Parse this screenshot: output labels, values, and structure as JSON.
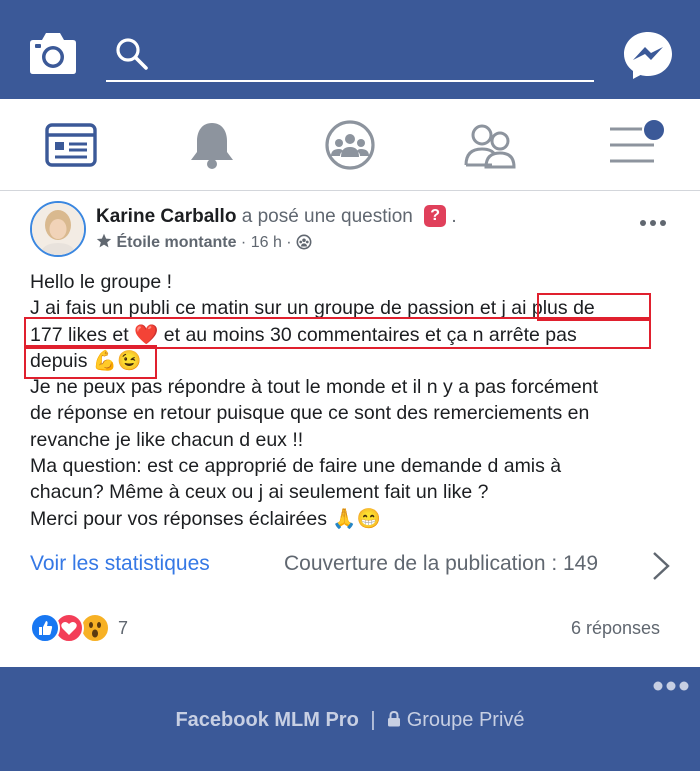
{
  "topbar": {
    "camera_icon": "camera-icon",
    "search_icon": "search-icon",
    "search_placeholder": "",
    "messenger_icon": "messenger-icon",
    "color": "#3b5998"
  },
  "nav": {
    "items": [
      {
        "name": "news-feed",
        "icon": "news-feed-icon",
        "active": true
      },
      {
        "name": "notifications",
        "icon": "bell-icon",
        "active": false
      },
      {
        "name": "groups",
        "icon": "groups-icon",
        "active": false
      },
      {
        "name": "friends",
        "icon": "friends-icon",
        "active": false
      },
      {
        "name": "menu",
        "icon": "menu-icon",
        "active": false,
        "has_dot": true
      }
    ]
  },
  "post": {
    "author": "Karine Carballo",
    "action": "a posé une question",
    "action_suffix": ".",
    "question_badge": "?",
    "badge_label": "Étoile montante",
    "time": "· 16 h ·",
    "text_lines": [
      "Hello le groupe !",
      "J ai fais un publi ce matin sur un groupe de passion et j ai plus de",
      "177 likes et ❤️ et au moins 30 commentaires et ça n arrête pas",
      "depuis 💪😉",
      "Je ne peux pas répondre à tout le monde et il n y a pas forcément",
      "de réponse en retour puisque que ce sont des remerciements en",
      "revanche je like chacun d eux !!",
      "Ma question: est ce approprié de faire une demande d amis à",
      "chacun? Même à ceux ou j ai seulement fait un like ?",
      "Merci pour vos réponses éclairées 🙏😁"
    ],
    "stats_link": "Voir les statistiques",
    "coverage": "Couverture de la publication : 149",
    "reaction_count": "7",
    "replies": "6 réponses",
    "highlight_color": "#e0202e"
  },
  "footer": {
    "brand": "Facebook MLM Pro",
    "separator": "|",
    "privacy": "Groupe Privé",
    "lock_icon": "lock-icon"
  }
}
